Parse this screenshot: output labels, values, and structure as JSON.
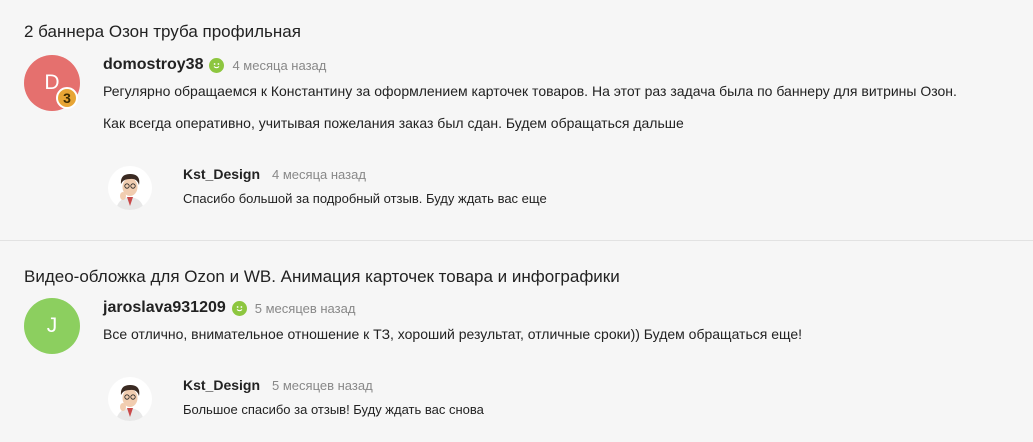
{
  "reviews": [
    {
      "title": "2 баннера Озон труба профильная",
      "author": {
        "name": "domostroy38",
        "initial": "D",
        "avatar_color": "#e5706e",
        "level": "3"
      },
      "time": "4 месяца назад",
      "text": [
        "Регулярно обращаемся к Константину за оформлением карточек товаров. На этот раз задача была по баннеру для витрины Озон.",
        "Как всегда оперативно, учитывая пожелания заказ был сдан. Будем обращаться дальше"
      ],
      "reply": {
        "name": "Kst_Design",
        "time": "4 месяца назад",
        "text": "Спасибо большой за подробный отзыв. Буду ждать вас еще"
      }
    },
    {
      "title": "Видео-обложка для Ozon и WB. Анимация карточек товара и инфографики",
      "author": {
        "name": "jaroslava931209",
        "initial": "J",
        "avatar_color": "#8ccf5f"
      },
      "time": "5 месяцев назад",
      "text": [
        "Все отлично, внимательное отношение к ТЗ, хороший результат, отличные сроки)) Будем обращаться еще!"
      ],
      "reply": {
        "name": "Kst_Design",
        "time": "5 месяцев назад",
        "text": "Большое спасибо за отзыв! Буду ждать вас снова"
      }
    }
  ],
  "icons": {
    "positive_rating": "smile-icon",
    "reply_avatar": "designer-portrait"
  }
}
